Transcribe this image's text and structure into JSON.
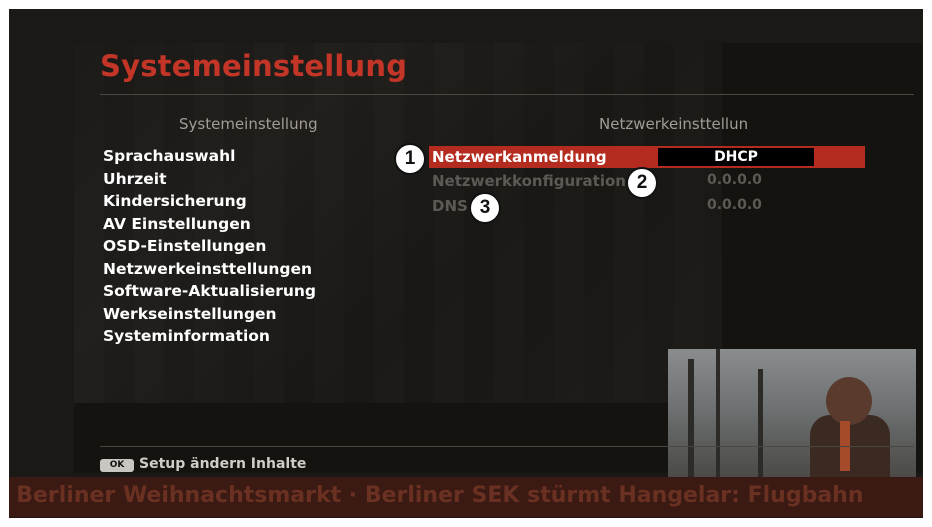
{
  "screen": {
    "title": "Systemeinstellung",
    "left_header": "Systemeinstellung",
    "right_header": "Netzwerkeinsttellun"
  },
  "menu": {
    "items": [
      {
        "label": "Sprachauswahl"
      },
      {
        "label": "Uhrzeit"
      },
      {
        "label": "Kindersicherung"
      },
      {
        "label": "AV Einstellungen"
      },
      {
        "label": "OSD-Einstellungen"
      },
      {
        "label": "Netzwerkeinsttellungen"
      },
      {
        "label": "Software-Aktualisierung"
      },
      {
        "label": "Werkseinstellungen"
      },
      {
        "label": "Systeminformation"
      }
    ]
  },
  "network": {
    "rows": [
      {
        "label": "Netzwerkanmeldung",
        "value": "DHCP",
        "selected": true
      },
      {
        "label": "Netzwerkkonfiguration",
        "value": "0.0.0.0",
        "selected": false
      },
      {
        "label": "DNS",
        "value": "0.0.0.0",
        "selected": false
      }
    ]
  },
  "markers": [
    "1",
    "2",
    "3"
  ],
  "footer": {
    "ok_label": "OK",
    "hint": "Setup ändern Inhalte"
  },
  "ticker": {
    "text": "f Berliner Weihnachtsmarkt · Berliner SEK stürmt Hangelar: Flugbahn"
  },
  "colors": {
    "accent": "#c23527",
    "selection": "#b42b1f",
    "text": "#ffffff",
    "disabled": "#5d5955"
  },
  "icons": {
    "ok": "ok-key-icon"
  }
}
